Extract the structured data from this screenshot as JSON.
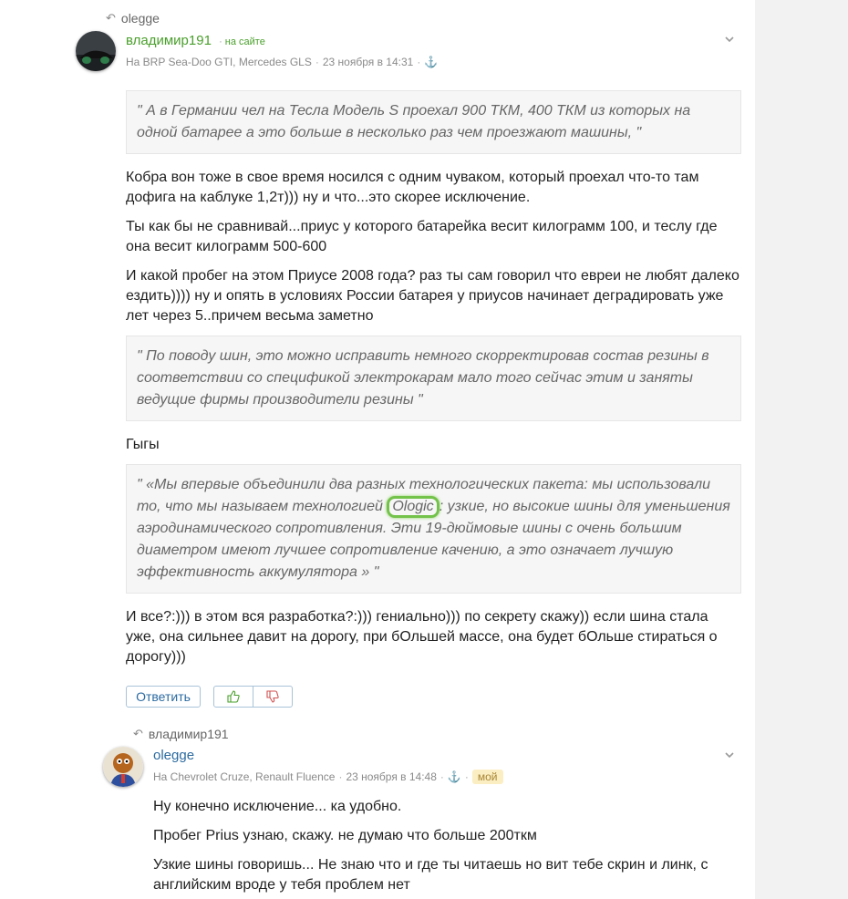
{
  "comment1": {
    "reply_to": "olegge",
    "author": "владимир191",
    "online": "на сайте",
    "meta_cars": "На  BRP Sea-Doo GTI, Mercedes GLS",
    "meta_date": "23 ноября в 14:31",
    "quote1": "\" А в Германии чел на Тесла Модель S проехал 900 ТКМ, 400 ТКМ из которых на одной батарее а это больше в несколько раз чем проезжают машины, \"",
    "para1": "Кобра вон тоже в свое время носился с одним чуваком, который проехал что-то там дофига на каблуке 1,2т))) ну и что...это скорее исключение.",
    "para2": "Ты как бы не сравнивай...приус у которого батарейка весит килограмм 100, и теслу где она весит килограмм 500-600",
    "para3": "И какой пробег на этом Приусе 2008 года? раз ты сам говорил что евреи не любят далеко ездить)))) ну и опять в условиях России батарея у приусов начинает деградировать уже лет через 5..причем весьма заметно",
    "quote2": "\" По поводу шин, это можно исправить немного скорректировав состав резины в соответствии со спецификой электрокарам мало того сейчас этим и заняты ведущие фирмы производители резины \"",
    "para4": "Гыгы",
    "quote3_before": "\" «Мы впервые объединили два разных технологических пакета: мы использовали то, что мы называем технологией ",
    "quote3_highlight": "Ologic",
    "quote3_after": ": узкие, но высокие шины для уменьшения аэродинамического сопротивления. Эти 19-дюймовые шины с очень большим диаметром имеют лучшее сопротивление качению, а это означает лучшую эффективность аккумулятора » \"",
    "para5": "И все?:))) в этом вся разработка?:))) гениально))) по секрету скажу)) если шина стала уже, она сильнее давит на дорогу, при бОльшей массе, она будет бОльше стираться о дорогу)))",
    "reply_button": "Ответить"
  },
  "comment2": {
    "reply_to": "владимир191",
    "author": "olegge",
    "meta_cars": "На  Chevrolet Cruze, Renault Fluence",
    "meta_date": "23 ноября в 14:48",
    "badge": "мой",
    "para1": "Ну конечно исключение... ка удобно.",
    "para2": "Пробег Prius узнаю, скажу. не думаю что больше 200ткм",
    "para3": "Узкие шины говоришь... Не знаю что и где ты читаешь но вит тебе скрин и линк, с английским вроде у тебя проблем нет"
  },
  "colors": {
    "author1": "#4aa02c",
    "author2": "#2b6aa0",
    "highlight": "#73c24a"
  }
}
